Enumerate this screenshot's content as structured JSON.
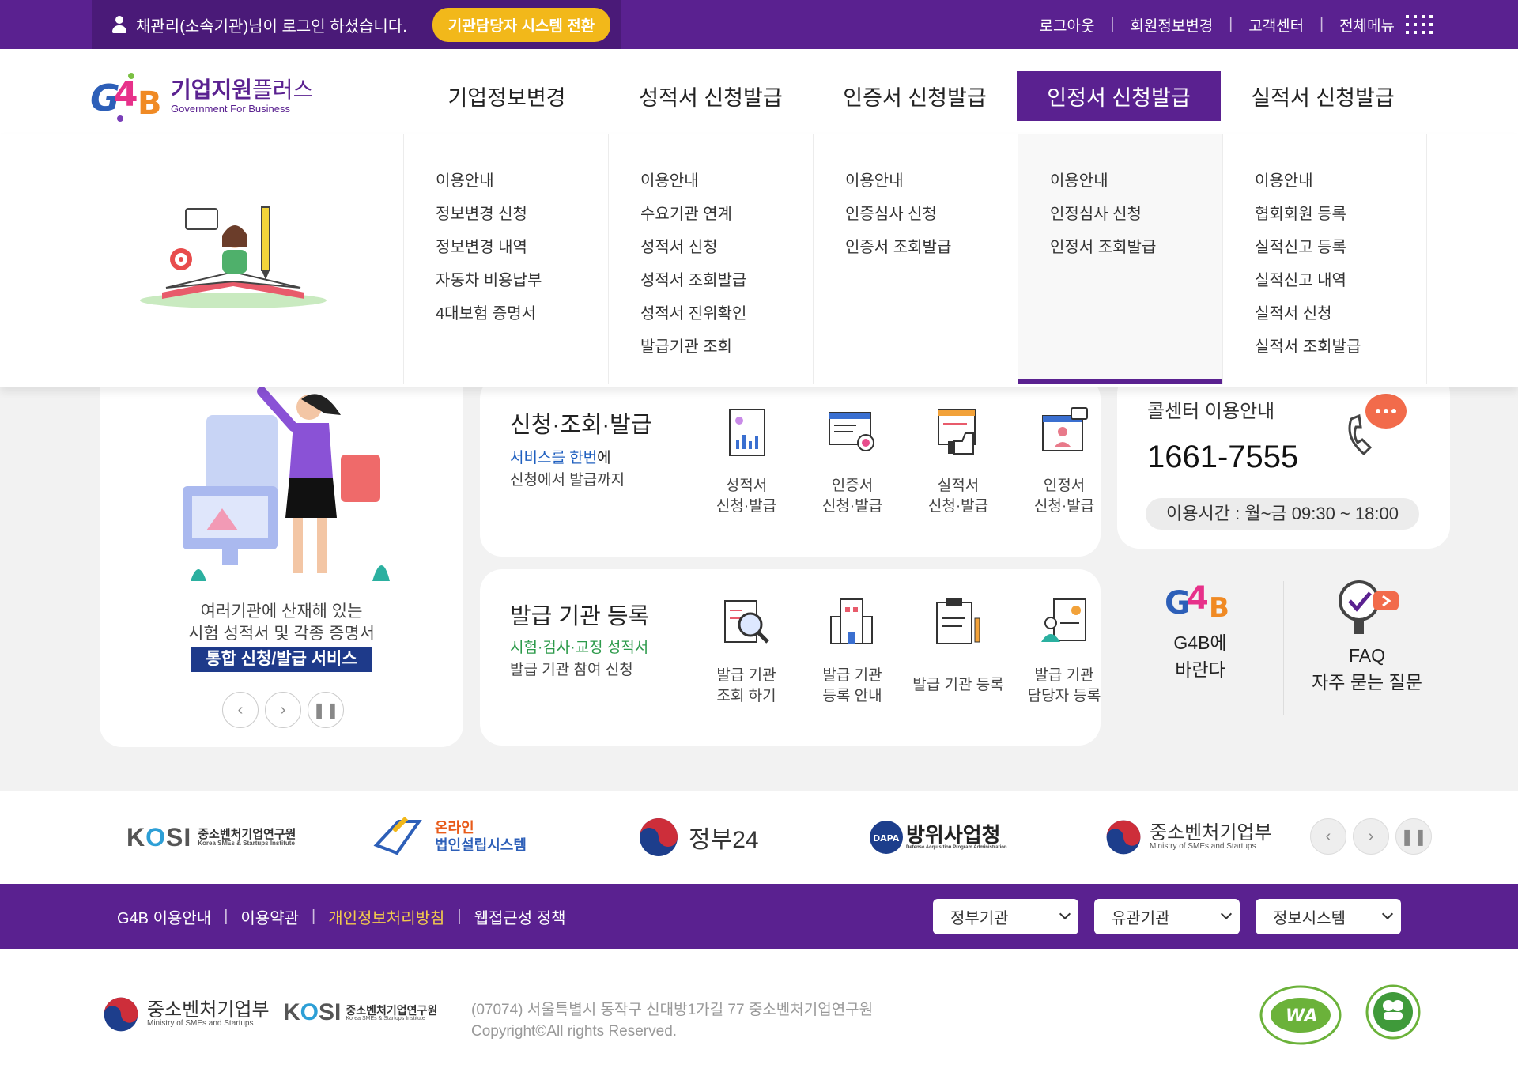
{
  "topbar": {
    "login_msg": "채관리(소속기관)님이 로그인 하셨습니다.",
    "switch_btn": "기관담당자 시스템 전환",
    "links": [
      "로그아웃",
      "회원정보변경",
      "고객센터",
      "전체메뉴"
    ]
  },
  "logo": {
    "mark": "G4B",
    "title_bold": "기업지원",
    "title_light": "플러스",
    "sub": "Government For Business"
  },
  "gnb": [
    "기업정보변경",
    "성적서 신청발급",
    "인증서 신청발급",
    "인정서 신청발급",
    "실적서 신청발급"
  ],
  "mega": [
    [
      "이용안내",
      "정보변경 신청",
      "정보변경 내역",
      "자동차 비용납부",
      "4대보험 증명서"
    ],
    [
      "이용안내",
      "수요기관 연계",
      "성적서 신청",
      "성적서 조회발급",
      "성적서 진위확인",
      "발급기관 조회"
    ],
    [
      "이용안내",
      "인증심사 신청",
      "인증서 조회발급"
    ],
    [
      "이용안내",
      "인정심사 신청",
      "인정서 조회발급"
    ],
    [
      "이용안내",
      "협회회원 등록",
      "실적신고 등록",
      "실적신고 내역",
      "실적서 신청",
      "실적서 조회발급"
    ]
  ],
  "slide": {
    "line1": "여러기관에 산재해 있는",
    "line2": "시험 성적서 및 각종 증명서",
    "badge": "통합 신청/발급 서비스"
  },
  "svc1": {
    "title": "신청·조회·발급",
    "sub_hl": "서비스를 한번",
    "sub_rest": "에",
    "sub2": "신청에서 발급까지",
    "items": [
      [
        "성적서",
        "신청·발급"
      ],
      [
        "인증서",
        "신청·발급"
      ],
      [
        "실적서",
        "신청·발급"
      ],
      [
        "인정서",
        "신청·발급"
      ]
    ]
  },
  "svc2": {
    "title": "발급 기관 등록",
    "sub_hl": "시험·검사·교정 성적서",
    "sub2": "발급 기관 참여 신청",
    "items": [
      [
        "발급 기관",
        "조회 하기"
      ],
      [
        "발급 기관",
        "등록 안내"
      ],
      [
        "발급 기관 등록",
        ""
      ],
      [
        "발급 기관",
        "담당자 등록"
      ]
    ]
  },
  "call": {
    "title": "콜센터 이용안내",
    "number": "1661-7555",
    "hours": "이용시간 : 월~금 09:30 ~ 18:00"
  },
  "quick": [
    [
      "G4B에",
      "바란다"
    ],
    [
      "FAQ",
      "자주 묻는 질문"
    ]
  ],
  "partners": [
    "중소벤처기업연구원",
    "Korea SMEs & Startups Institute",
    "온라인",
    "법인설립시스템",
    "정부24",
    "방위사업청",
    "Defense Acquisition Program Administration",
    "중소벤처기업부",
    "Ministry of SMEs and Startups"
  ],
  "footer": {
    "links": [
      "G4B 이용안내",
      "이용약관",
      "개인정보처리방침",
      "웹접근성 정책"
    ],
    "selects": [
      "정부기관",
      "유관기관",
      "정보시스템"
    ],
    "address": "(07074) 서울특별시 동작구 신대방1가길 77 중소벤처기업연구원",
    "copyright": "Copyright©All rights Reserved."
  },
  "colors": {
    "brand": "#5a2190",
    "accent": "#f2b81a",
    "highlight": "#f2c94c"
  }
}
